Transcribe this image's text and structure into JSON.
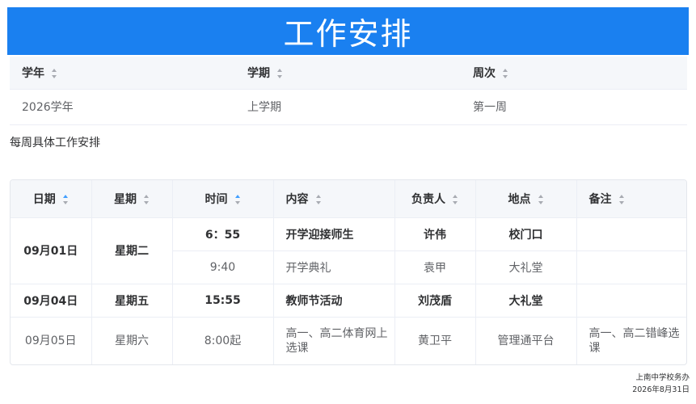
{
  "header": {
    "title": "工作安排"
  },
  "info_table": {
    "columns": [
      "学年",
      "学期",
      "周次"
    ],
    "row": [
      "2026学年",
      "上学期",
      "第一周"
    ]
  },
  "section_label": "每周具体工作安排",
  "schedule": {
    "columns": [
      "日期",
      "星期",
      "时间",
      "内容",
      "负责人",
      "地点",
      "备注"
    ],
    "sorted_columns": [
      "日期",
      "时间"
    ],
    "rows": [
      {
        "date": "09月01日",
        "weekday": "星期二",
        "time": "6：55",
        "content": "开学迎接师生",
        "owner": "许伟",
        "location": "校门口",
        "note": ""
      },
      {
        "date": "09月01日",
        "weekday": "星期二",
        "time": "9:40",
        "content": "开学典礼",
        "owner": "袁甲",
        "location": "大礼堂",
        "note": ""
      },
      {
        "date": "09月04日",
        "weekday": "星期五",
        "time": "15:55",
        "content": "教师节活动",
        "owner": "刘茂盾",
        "location": "大礼堂",
        "note": ""
      },
      {
        "date": "09月05日",
        "weekday": "星期六",
        "time": "8:00起",
        "content": "高一、高二体育网上选课",
        "owner": "黄卫平",
        "location": "管理通平台",
        "note": "高一、高二错峰选课"
      }
    ]
  },
  "footer": {
    "office": "上南中学校务办",
    "date": "2026年8月31日"
  },
  "colors": {
    "accent": "#1a80f0",
    "sort_active": "#409eff",
    "header_bg": "#f5f7fa"
  }
}
